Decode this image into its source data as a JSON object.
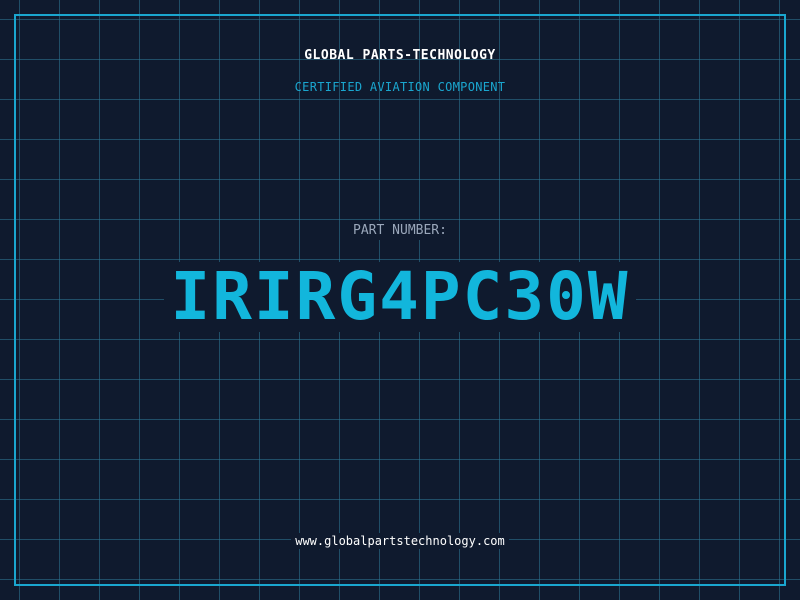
{
  "header": {
    "company": "GLOBAL PARTS-TECHNOLOGY",
    "tagline": "CERTIFIED AVIATION COMPONENT"
  },
  "part": {
    "label": "PART NUMBER:",
    "number": "IRIRG4PC30W"
  },
  "footer": {
    "url": "www.globalpartstechnology.com"
  },
  "colors": {
    "background": "#0f1a2e",
    "accent": "#1aa6cf",
    "part_number": "#12b6dc",
    "label": "#9aa7ba",
    "text": "#ffffff"
  }
}
